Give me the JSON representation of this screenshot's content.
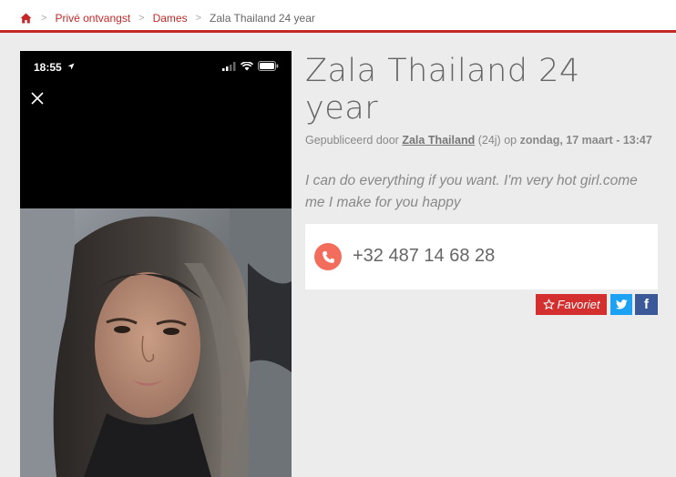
{
  "breadcrumb": {
    "home_icon": "home-icon",
    "separator": ">",
    "items": [
      "Privé ontvangst",
      "Dames"
    ],
    "current": "Zala Thailand 24 year"
  },
  "photo": {
    "status_time": "18:55",
    "close_icon": "close-icon"
  },
  "listing": {
    "title": "Zala Thailand 24 year",
    "meta_prefix": "Gepubliceerd door",
    "author": "Zala Thailand",
    "author_age": "(24j)",
    "meta_on": "op",
    "date": "zondag, 17 maart - 13:47",
    "description": "I can do everything if you want. I'm very hot girl.come me I make for you happy",
    "phone": "+32 487 14 68 28"
  },
  "actions": {
    "favorite_label": "Favoriet",
    "twitter_icon": "twitter-icon",
    "facebook_label": "f"
  },
  "colors": {
    "accent": "#c62828",
    "phone_icon_bg": "#f26d5c",
    "twitter": "#1da1f2",
    "facebook": "#3b5998"
  }
}
